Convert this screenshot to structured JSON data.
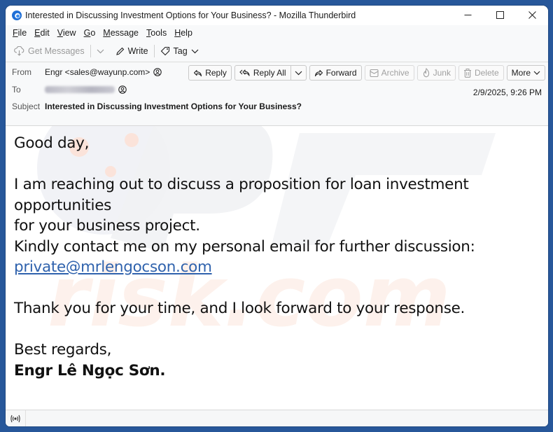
{
  "window": {
    "title": "Interested in Discussing Investment Options for Your Business? - Mozilla Thunderbird",
    "controls": {
      "minimize": "—",
      "maximize": "☐",
      "close": "✕"
    }
  },
  "menubar": {
    "items": [
      {
        "label": "File",
        "accel": "F",
        "rest": "ile"
      },
      {
        "label": "Edit",
        "accel": "E",
        "rest": "dit"
      },
      {
        "label": "View",
        "accel": "V",
        "rest": "iew"
      },
      {
        "label": "Go",
        "accel": "G",
        "rest": "o"
      },
      {
        "label": "Message",
        "accel": "M",
        "rest": "essage"
      },
      {
        "label": "Tools",
        "accel": "T",
        "rest": "ools"
      },
      {
        "label": "Help",
        "accel": "H",
        "rest": "elp"
      }
    ]
  },
  "toolbar": {
    "get_messages": "Get Messages",
    "write": "Write",
    "tag": "Tag"
  },
  "header": {
    "from_label": "From",
    "from_value": "Engr <sales@wayunp.com>",
    "to_label": "To",
    "to_value_redacted": true,
    "subject_label": "Subject",
    "subject_value": "Interested in Discussing Investment Options for Your Business?",
    "date": "2/9/2025, 9:26 PM",
    "actions": {
      "reply": "Reply",
      "reply_all": "Reply All",
      "forward": "Forward",
      "archive": "Archive",
      "junk": "Junk",
      "delete": "Delete",
      "more": "More"
    }
  },
  "message": {
    "greeting": "Good day,",
    "line1": "I am reaching out to discuss a proposition for loan investment opportunities",
    "line2": "for your business project.",
    "line3": "Kindly contact me on my personal email for further discussion:",
    "email_link": "private@mrlengocson.com",
    "line4": "Thank you for your time, and I look forward to your response.",
    "closing": "Best regards,",
    "signature": "Engr Lê Ngọc Sơn."
  },
  "statusbar": {
    "activity_icon": "((o))"
  },
  "colors": {
    "desktop": "#27579a",
    "link": "#2f62ad"
  }
}
